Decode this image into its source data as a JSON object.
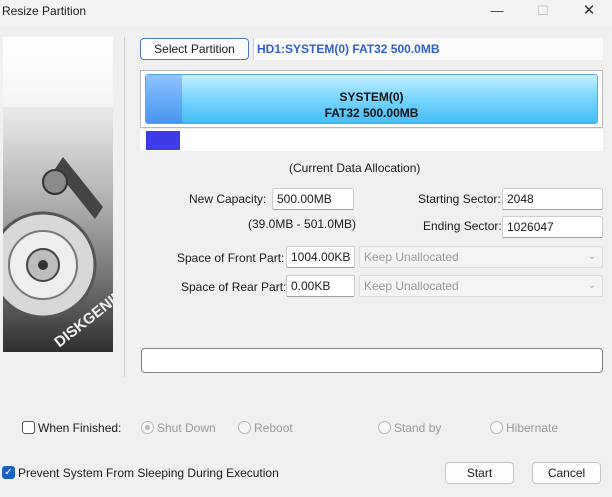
{
  "window": {
    "title": "Resize Partition",
    "minimize_glyph": "—",
    "maximize_glyph": "☐",
    "close_glyph": "✕"
  },
  "sidebar": {
    "brand_text": "DISKGENIUS"
  },
  "partition": {
    "select_button": "Select Partition",
    "disk_label": "HD1:SYSTEM(0) FAT32 500.0MB",
    "bar_name": "SYSTEM(0)",
    "bar_info": "FAT32 500.00MB",
    "allocation_caption": "(Current Data Allocation)"
  },
  "fields": {
    "new_capacity_label": "New Capacity:",
    "new_capacity_value": "500.00MB",
    "capacity_range": "(39.0MB - 501.0MB)",
    "starting_sector_label": "Starting Sector:",
    "starting_sector_value": "2048",
    "ending_sector_label": "Ending Sector:",
    "ending_sector_value": "1026047",
    "front_label": "Space of Front Part:",
    "front_value": "1004.00KB",
    "front_option": "Keep Unallocated",
    "rear_label": "Space of Rear Part:",
    "rear_value": "0.00KB",
    "rear_option": "Keep Unallocated"
  },
  "finish": {
    "when_finished_label": "When Finished:",
    "options": [
      "Shut Down",
      "Reboot",
      "Stand by",
      "Hibernate"
    ]
  },
  "prevent_sleep_label": "Prevent System From Sleeping During Execution",
  "buttons": {
    "start": "Start",
    "cancel": "Cancel"
  },
  "colors": {
    "accent": "#3060d0",
    "partition_fill": "#45bcf6",
    "allocation_fill": "#3b3bea"
  }
}
